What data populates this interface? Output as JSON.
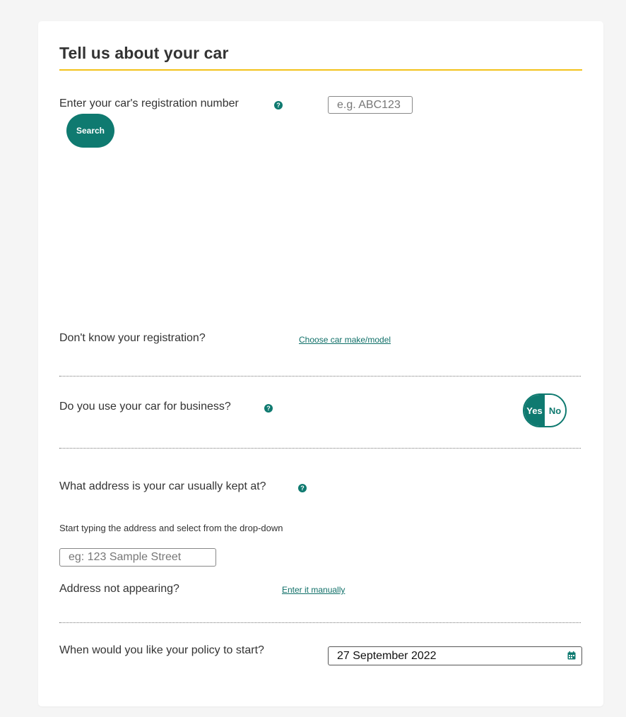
{
  "section": {
    "title": "Tell us about your car"
  },
  "registration": {
    "label": "Enter your car's registration number",
    "help_icon": "question-circle-icon",
    "input_placeholder": "e.g. ABC123",
    "input_value": "",
    "search_label": "Search"
  },
  "unknown_registration": {
    "label": "Don't know your registration?",
    "link_text": "Choose car make/model"
  },
  "business_use": {
    "label": "Do you use your car for business?",
    "help_icon": "question-circle-icon",
    "yes_label": "Yes",
    "no_label": "No",
    "selected": "Yes"
  },
  "address": {
    "label": "What address is your car usually kept at?",
    "help_icon": "question-circle-icon",
    "helper_text": "Start typing the address and select from the drop-down",
    "input_placeholder": "eg: 123 Sample Street",
    "input_value": "",
    "not_appearing_label": "Address not appearing?",
    "manual_link_text": "Enter it manually"
  },
  "policy_start": {
    "label": "When would you like your policy to start?",
    "date_value": "27 September 2022",
    "calendar_icon": "calendar-icon"
  },
  "colors": {
    "accent": "#0f7a70",
    "title_rule": "#f3c21a",
    "background": "#f5f5f5",
    "card": "#ffffff"
  }
}
